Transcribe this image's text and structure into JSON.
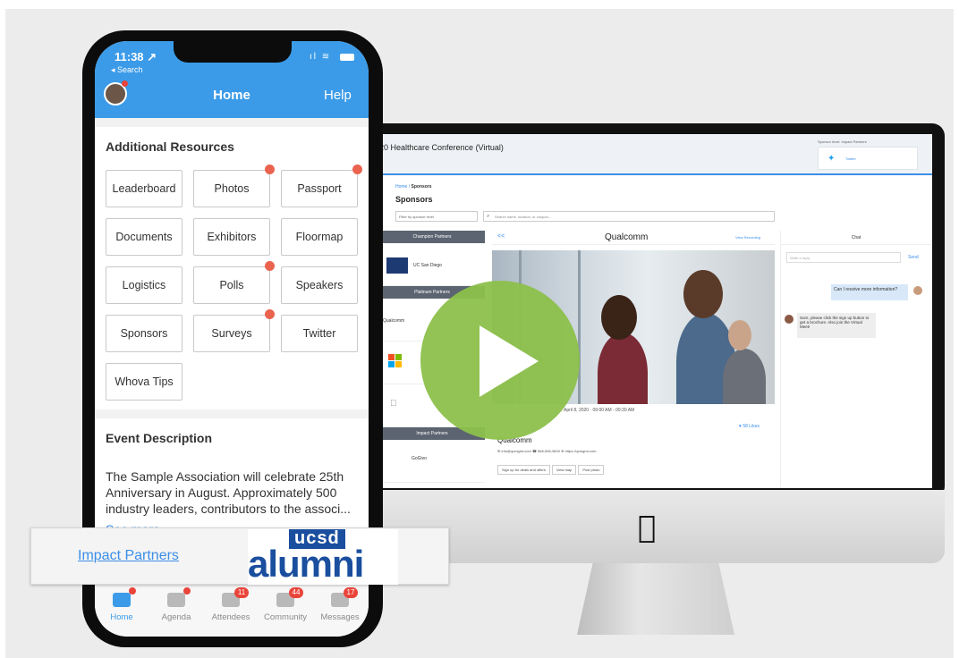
{
  "phone": {
    "time": "11:38 ↗",
    "back_label": "◂ Search",
    "header_title": "Home",
    "help_label": "Help",
    "resources_title": "Additional Resources",
    "resources": [
      {
        "label": "Leaderboard",
        "dot": false
      },
      {
        "label": "Photos",
        "dot": true
      },
      {
        "label": "Passport",
        "dot": true
      },
      {
        "label": "Documents",
        "dot": false
      },
      {
        "label": "Exhibitors",
        "dot": false
      },
      {
        "label": "Floormap",
        "dot": false
      },
      {
        "label": "Logistics",
        "dot": false
      },
      {
        "label": "Polls",
        "dot": true
      },
      {
        "label": "Speakers",
        "dot": false
      },
      {
        "label": "Sponsors",
        "dot": false
      },
      {
        "label": "Surveys",
        "dot": true
      },
      {
        "label": "Twitter",
        "dot": false
      },
      {
        "label": "Whova Tips",
        "dot": false
      }
    ],
    "description_title": "Event Description",
    "description_text": "The Sample Association will celebrate 25th Anniversary in August. Approximately 500 industry leaders, contributors to the associ...",
    "see_more": "See more",
    "tabs": [
      {
        "label": "Home",
        "badge": "",
        "active": true
      },
      {
        "label": "Agenda",
        "badge": "",
        "active": false
      },
      {
        "label": "Attendees",
        "badge": "11",
        "active": false
      },
      {
        "label": "Community",
        "badge": "44",
        "active": false
      },
      {
        "label": "Messages",
        "badge": "17",
        "active": false
      }
    ]
  },
  "desktop": {
    "conference_title": "20 Healthcare Conference (Virtual)",
    "sponsor_label": "Sponsor level: Impact Partners",
    "twitter_label": "Twitter",
    "breadcrumb_home": "Home",
    "breadcrumb_sep": " / ",
    "breadcrumb_current": "Sponsors",
    "page_title": "Sponsors",
    "filter_placeholder": "Filter by sponsor level",
    "search_placeholder": "Search name, location, or coupon...",
    "left_sections": {
      "champion": "Champion Partners",
      "champion_sponsor": "UC San Diego",
      "platinum": "Platinum Partners",
      "platinum_sponsor": "Qualcomm",
      "impact": "Impact Partners",
      "impact_sponsor": "GoGivo"
    },
    "detail_back": "<<",
    "detail_name": "Qualcomm",
    "view_recording": "View Recording",
    "date_text": "April 8, 2020 · 09:00 AM - 09:30 AM",
    "likes": "♥ 58 Likes",
    "company_name": "Qualcomm",
    "contacts": "✉ info@qcmgmt.com   ☎ 858-836-9600   ⊕ https://qcmgmt.com",
    "actions": [
      "Sign up for deals and offers",
      "View map",
      "Post photo"
    ],
    "chat_title": "Chat",
    "chat_placeholder": "Write a reply",
    "chat_send": "Send",
    "chat_msg_right": "Can I receive more information?",
    "chat_msg_left": "Sure, please click the sign up button to get a brochure. Also join the Virtual Meet!"
  },
  "banner": {
    "link_text": "Impact Partners",
    "logo_top": "ucsd",
    "logo_bottom": "alumni"
  },
  "colors": {
    "accent": "#3b9be8",
    "play": "#8cc04b",
    "badge": "#e9443a",
    "logo": "#1a4e9e"
  },
  "icons": [
    "play-icon",
    "apple-logo-icon",
    "twitter-bird-icon",
    "search-icon",
    "home-icon",
    "agenda-icon",
    "attendees-icon",
    "community-icon",
    "messages-icon"
  ]
}
